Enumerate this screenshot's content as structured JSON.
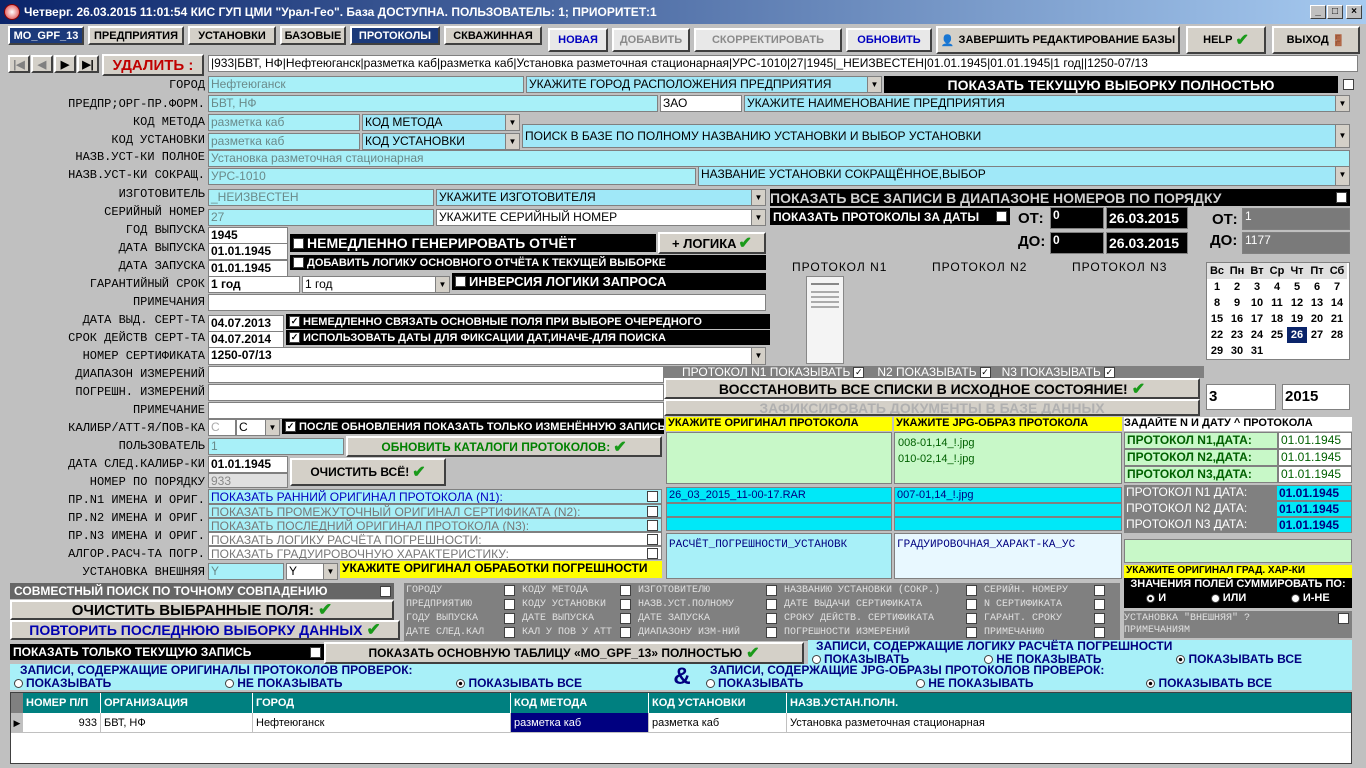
{
  "title": "Четверг. 26.03.2015 11:01:54 КИС ГУП ЦМИ \"Урал-Гео\". База ДОСТУПНА. ПОЛЬЗОВАТЕЛЬ: 1; ПРИОРИТЕТ:1",
  "tabs": [
    "MO_GPF_13",
    "ПРЕДПРИЯТИЯ",
    "УСТАНОВКИ",
    "БАЗОВЫЕ",
    "ПРОТОКОЛЫ",
    "СКВАЖИННАЯ"
  ],
  "actions": {
    "new": "НОВАЯ",
    "add": "ДОБАВИТЬ",
    "correct": "СКОРРЕКТИРОВАТЬ",
    "refresh": "ОБНОВИТЬ",
    "finish": "ЗАВЕРШИТЬ РЕДАКТИРОВАНИЕ БАЗЫ",
    "help": "HELP",
    "exit": "ВЫХОД"
  },
  "delete_label": "УДАЛИТЬ :",
  "record_summary": "|933|БВТ, НФ|Нефтеюганск|разметка каб|разметка каб|Установка разметочная стационарная|УРС-1010|27|1945|_НЕИЗВЕСТЕН|01.01.1945|01.01.1945|1 год||1250-07/13",
  "labels": {
    "city": "ГОРОД",
    "enterprise": "ПРЕДПР;ОРГ-ПР.ФОРМ.",
    "method": "КОД МЕТОДА",
    "install": "КОД УСТАНОВКИ",
    "full_name": "НАЗВ.УСТ-КИ ПОЛНОЕ",
    "short_name": "НАЗВ.УСТ-КИ СОКРАЩ.",
    "maker": "ИЗГОТОВИТЕЛЬ",
    "serial": "СЕРИЙНЫЙ НОМЕР",
    "year": "ГОД ВЫПУСКА",
    "rel_date": "ДАТА ВЫПУСКА",
    "start_date": "ДАТА ЗАПУСКА",
    "warranty": "ГАРАНТИЙНЫЙ СРОК",
    "notes": "ПРИМЕЧАНИЯ",
    "cert_date": "ДАТА ВЫД. СЕРТ-ТА",
    "cert_term": "СРОК ДЕЙСТВ СЕРТ-ТА",
    "cert_no": "НОМЕР СЕРТИФИКАТА",
    "range": "ДИАПАЗОН ИЗМЕРЕНИЙ",
    "error": "ПОГРЕШН. ИЗМЕРЕНИЙ",
    "note2": "ПРИМЕЧАНИЕ",
    "calib": "КАЛИБР/АТТ-Я/ПОВ-КА",
    "user": "ПОЛЬЗОВАТЕЛЬ",
    "next_calib": "ДАТА СЛЕД.КАЛИБР-КИ",
    "order_no": "НОМЕР ПО ПОРЯДКУ",
    "pr1": "ПР.N1 ИМЕНА И ОРИГ.",
    "pr2": "ПР.N2 ИМЕНА И ОРИГ.",
    "pr3": "ПР.N3 ИМЕНА И ОРИГ.",
    "algo": "АЛГОР.РАСЧ-ТА ПОГР.",
    "external": "УСТАНОВКА ВНЕШНЯЯ"
  },
  "values": {
    "city": "Нефтеюганск",
    "enterprise": "БВТ, НФ",
    "form": "ЗАО",
    "method": "разметка каб",
    "install": "разметка каб",
    "full_name": "Установка разметочная стационарная",
    "short_name": "УРС-1010",
    "maker": "_НЕИЗВЕСТЕН",
    "serial": "27",
    "year": "1945",
    "rel_date": "01.01.1945",
    "start_date": "01.01.1945",
    "warranty": "1 год",
    "warranty_sel": "1 год",
    "cert_date": "04.07.2013",
    "cert_term": "04.07.2014",
    "cert_no": "1250-07/13",
    "calib": "С",
    "calib_sel": "С",
    "user": "1",
    "next_calib": "01.01.1945",
    "order_no": "933",
    "external": "Y",
    "external_sel": "Y"
  },
  "hints": {
    "city": "УКАЖИТЕ ГОРОД РАСПОЛОЖЕНИЯ ПРЕДПРИЯТИЯ",
    "enterprise": "УКАЖИТЕ НАИМЕНОВАНИЕ ПРЕДПРИЯТИЯ",
    "method": "КОД МЕТОДА",
    "install": "КОД УСТАНОВКИ",
    "search": "ПОИСК В БАЗЕ ПО ПОЛНОМУ НАЗВАНИЮ УСТАНОВКИ И ВЫБОР УСТАНОВКИ",
    "short": "НАЗВАНИЕ УСТАНОВКИ СОКРАЩЁННОЕ,ВЫБОР",
    "maker": "УКАЖИТЕ ИЗГОТОВИТЕЛЯ",
    "serial": "УКАЖИТЕ СЕРИЙНЫЙ НОМЕР"
  },
  "show_all": "ПОКАЗАТЬ ТЕКУЩУЮ ВЫБОРКУ ПОЛНОСТЬЮ",
  "show_range": "ПОКАЗАТЬ ВСЕ ЗАПИСИ В ДИАПАЗОНЕ НОМЕРОВ ПО ПОРЯДКУ",
  "show_dates": "ПОКАЗАТЬ ПРОТОКОЛЫ ЗА ДАТЫ",
  "from": "ОТ:",
  "to": "ДО:",
  "from_n": "0",
  "to_n": "0",
  "from_date": "26.03.2015",
  "to_date": "26.03.2015",
  "from_rec": "1",
  "to_rec": "1177",
  "opts": {
    "gen_report": "НЕМЕДЛЕННО ГЕНЕРИРОВАТЬ ОТЧЁТ",
    "logic": "+ ЛОГИКА",
    "add_logic": "ДОБАВИТЬ ЛОГИКУ ОСНОВНОГО ОТЧЁТА К ТЕКУЩЕЙ ВЫБОРКЕ",
    "invert": "ИНВЕРСИЯ ЛОГИКИ ЗАПРОСА",
    "link": "НЕМЕДЛЕННО СВЯЗАТЬ ОСНОВНЫЕ ПОЛЯ ПРИ ВЫБОРЕ ОЧЕРЕДНОГО",
    "use_dates": "ИСПОЛЬЗОВАТЬ ДАТЫ ДЛЯ ФИКСАЦИИ ДАТ,ИНАЧЕ-ДЛЯ ПОИСКА",
    "after_update": "ПОСЛЕ ОБНОВЛЕНИЯ ПОКАЗАТЬ ТОЛЬКО ИЗМЕНЁННУЮ ЗАПИСЬ"
  },
  "protocols": {
    "p1": "ПРОТОКОЛ N1",
    "p2": "ПРОТОКОЛ N2",
    "p3": "ПРОТОКОЛ N3",
    "show1": "ПРОТОКОЛ  N1  ПОКАЗЫВАТЬ",
    "show2": "N2 ПОКАЗЫВАТЬ",
    "show3": "N3  ПОКАЗЫВАТЬ"
  },
  "restore": "ВОССТАНОВИТЬ ВСЕ СПИСКИ В ИСХОДНОЕ СОСТОЯНИЕ!",
  "fix_docs": "ЗАФИКСИРОВАТЬ ДОКУМЕНТЫ В БАЗЕ ДАННЫХ",
  "update_catalogs": "ОБНОВИТЬ КАТАЛОГИ ПРОТОКОЛОВ:",
  "clear_all": "ОЧИСТИТЬ ВСЁ!",
  "orig_hdr": "УКАЖИТЕ ОРИГИНАЛ ПРОТОКОЛА",
  "jpg_hdr": "УКАЖИТЕ JPG-ОБРАЗ ПРОТОКОЛА",
  "date_hdr": "ЗАДАЙТЕ N И ДАТУ ^ ПРОТОКОЛА",
  "jpg_files": [
    "008-01,14_!.jpg",
    "010-02,14_!.jpg"
  ],
  "rar_file": "26_03_2015_11-00-17.RAR",
  "jpg_file2": "007-01,14_!.jpg",
  "calc_file": "РАСЧЁТ_ПОГРЕШНОСТИ_УСТАНОВК",
  "grad_file": "ГРАДУИРОВОЧНАЯ_ХАРАКТ-КА_УС",
  "prot_dates": [
    {
      "l": "ПРОТОКОЛ N1,ДАТА:",
      "v": "01.01.1945"
    },
    {
      "l": "ПРОТОКОЛ N2,ДАТА:",
      "v": "01.01.1945"
    },
    {
      "l": "ПРОТОКОЛ N3,ДАТА:",
      "v": "01.01.1945"
    }
  ],
  "prot_dates2": [
    {
      "l": "ПРОТОКОЛ N1 ДАТА:",
      "v": "01.01.1945"
    },
    {
      "l": "ПРОТОКОЛ N2 ДАТА:",
      "v": "01.01.1945"
    },
    {
      "l": "ПРОТОКОЛ N3 ДАТА:",
      "v": "01.01.1945"
    }
  ],
  "show_links": [
    "ПОКАЗАТЬ РАННИЙ ОРИГИНАЛ ПРОТОКОЛА (N1):",
    "ПОКАЗАТЬ ПРОМЕЖУТОЧНЫЙ ОРИГИНАЛ СЕРТИФИКАТА (N2):",
    "ПОКАЗАТЬ ПОСЛЕДНИЙ ОРИГИНАЛ ПРОТОКОЛА (N3):",
    "ПОКАЗАТЬ ЛОГИКУ РАСЧЁТА ПОГРЕШНОСТИ:",
    "ПОКАЗАТЬ ГРАДУИРОВОЧНУЮ ХАРАКТЕРИСТИКУ:"
  ],
  "orig_calc": "УКАЖИТЕ ОРИГИНАЛ ОБРАБОТКИ ПОГРЕШНОСТИ",
  "orig_grad": "УКАЖИТЕ ОРИГИНАЛ ГРАД. ХАР-КИ",
  "joint_search": "СОВМЕСТНЫЙ ПОИСК ПО ТОЧНОМУ СОВПАДЕНИЮ",
  "clear_fields": "ОЧИСТИТЬ ВЫБРАННЫЕ ПОЛЯ:",
  "repeat_last": "ПОВТОРИТЬ ПОСЛЕДНЮЮ ВЫБОРКУ ДАННЫХ",
  "show_current": "ПОКАЗАТЬ ТОЛЬКО ТЕКУЩУЮ ЗАПИСЬ",
  "show_main": "ПОКАЗАТЬ ОСНОВНУЮ ТАБЛИЦУ «MO_GPF_13» ПОЛНОСТЬЮ",
  "field_checks": [
    "ГОРОДУ",
    "ПРЕДПРИЯТИЮ",
    "ГОДУ ВЫПУСКА",
    "ДАТЕ СЛЕД.КАЛ",
    "КОДУ МЕТОДА",
    "КОДУ УСТАНОВКИ",
    "ДАТЕ ВЫПУСКА",
    "КАЛ У ПОВ У АТТ",
    "ИЗГОТОВИТЕЛЮ",
    "НАЗВ.УСТ.ПОЛНОМУ",
    "ДАТЕ ЗАПУСКА",
    "ДИАПАЗОНУ ИЗМ-НИЙ",
    "НАЗВАНИЮ УСТАНОВКИ (СОКР.)",
    "ДАТЕ ВЫДАЧИ СЕРТИФИКАТА",
    "СРОКУ ДЕЙСТВ. СЕРТИФИКАТА",
    "ПОГРЕШНОСТИ ИЗМЕРЕНИЙ",
    "СЕРИЙН. НОМЕРУ",
    "N СЕРТИФИКАТА",
    "ГАРАНТ. СРОКУ",
    "ПРИМЕЧАНИЮ",
    "УСТАНОВКА \"ВНЕШНЯЯ\" ?",
    "ПРИМЕЧАНИЯМ"
  ],
  "sum_title": "ЗНАЧЕНИЯ ПОЛЕЙ СУММИРОВАТЬ ПО:",
  "sum_opts": [
    "И",
    "ИЛИ",
    "И-НЕ"
  ],
  "logic_records": "ЗАПИСИ, СОДЕРЖАЩИЕ ЛОГИКУ  РАСЧЁТА ПОГРЕШНОСТИ",
  "orig_records": "ЗАПИСИ, СОДЕРЖАЩИЕ ОРИГИНАЛЫ ПРОТОКОЛОВ ПРОВЕРОК:",
  "jpg_records": "ЗАПИСИ, СОДЕРЖАЩИЕ JPG-ОБРАЗЫ ПРОТОКОЛОВ ПРОВЕРОК:",
  "amp": "&",
  "radio3": [
    "ПОКАЗЫВАТЬ",
    "НЕ ПОКАЗЫВАТЬ",
    "ПОКАЗЫВАТЬ ВСЕ"
  ],
  "cal_days": [
    "Вс",
    "Пн",
    "Вт",
    "Ср",
    "Чт",
    "Пт",
    "Сб"
  ],
  "cal_rows": [
    [
      "1",
      "2",
      "3",
      "4",
      "5",
      "6",
      "7"
    ],
    [
      "8",
      "9",
      "10",
      "11",
      "12",
      "13",
      "14"
    ],
    [
      "15",
      "16",
      "17",
      "18",
      "19",
      "20",
      "21"
    ],
    [
      "22",
      "23",
      "24",
      "25",
      "26",
      "27",
      "28"
    ],
    [
      "29",
      "30",
      "31",
      "",
      "",
      "",
      ""
    ]
  ],
  "cal_month": "3",
  "cal_year": "2015",
  "table": {
    "headers": [
      "НОМЕР П/П",
      "ОРГАНИЗАЦИЯ",
      "ГОРОД",
      "КОД МЕТОДА",
      "КОД УСТАНОВКИ",
      "НАЗВ.УСТАН.ПОЛН."
    ],
    "row": [
      "933",
      "БВТ, НФ",
      "Нефтеюганск",
      "разметка каб",
      "разметка каб",
      "Установка разметочная стационарная"
    ]
  },
  "icons": {
    "check": "✔",
    "pointer": "▶",
    "down": "▼",
    "up": "▲"
  }
}
